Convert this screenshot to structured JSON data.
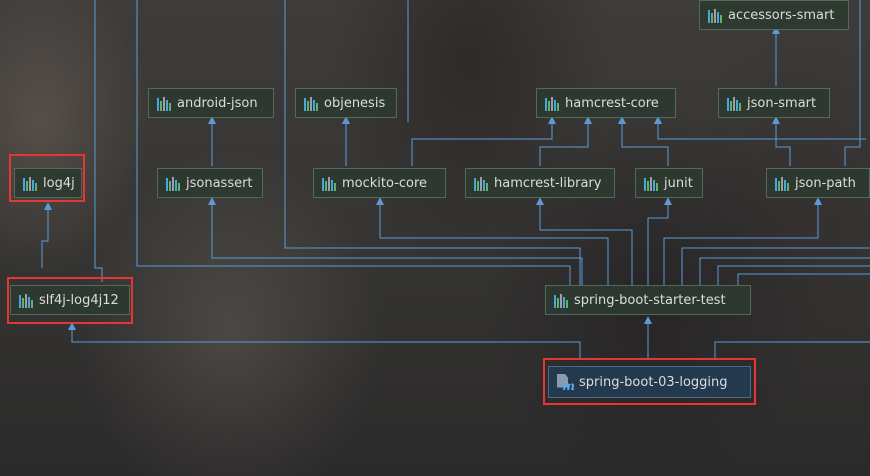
{
  "nodes": {
    "accessors_smart": "accessors-smart",
    "android_json": "android-json",
    "objenesis": "objenesis",
    "hamcrest_core": "hamcrest-core",
    "json_smart": "json-smart",
    "log4j": "log4j",
    "jsonassert": "jsonassert",
    "mockito_core": "mockito-core",
    "hamcrest_library": "hamcrest-library",
    "junit": "junit",
    "json_path": "json-path",
    "slf4j_log4j12": "slf4j-log4j12",
    "spring_boot_starter_test": "spring-boot-starter-test",
    "root": "spring-boot-03-logging"
  },
  "icons": {
    "library": "library-icon",
    "maven": "maven-module-icon"
  },
  "colors": {
    "edge": "#5b9bd5",
    "highlight": "#e53535",
    "node_bg": "#2c3a30",
    "root_bg": "#23394d"
  }
}
